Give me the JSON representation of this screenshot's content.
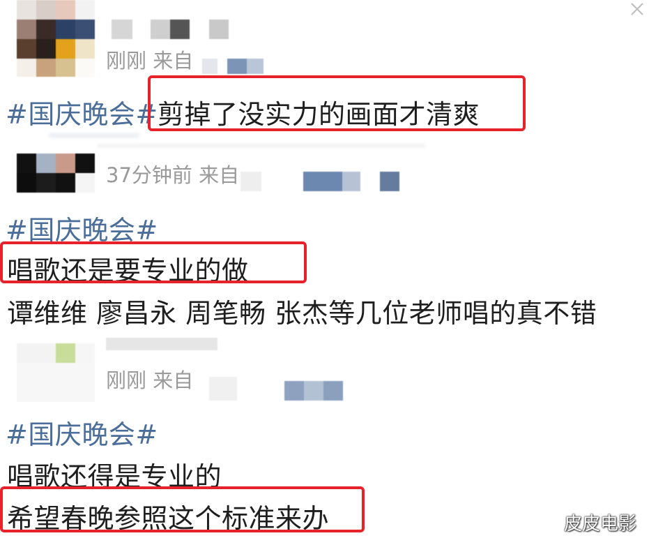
{
  "posts": [
    {
      "meta": "刚刚  来自",
      "topic": "#国庆晚会#",
      "text": "剪掉了没实力的画面才清爽"
    },
    {
      "meta": "37分钟前  来自",
      "topic": "#国庆晚会#",
      "lines": [
        "唱歌还是要专业的做",
        "谭维维 廖昌永 周笔畅 张杰等几位老师唱的真不错"
      ]
    },
    {
      "meta": "刚刚  来自",
      "topic": "#国庆晚会#",
      "lines": [
        "唱歌还得是专业的",
        "希望春晚参照这个标准来办"
      ]
    }
  ],
  "watermark": "皮皮电影",
  "colors": {
    "topic": "#4a6d99",
    "highlight_box": "#e8222a",
    "meta": "#9a9a9a"
  }
}
